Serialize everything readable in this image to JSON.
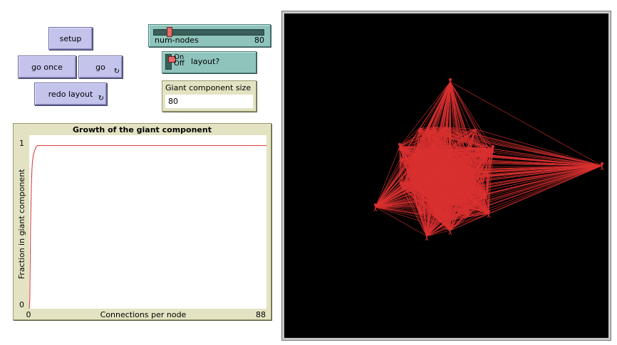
{
  "buttons": {
    "setup": "setup",
    "go_once": "go once",
    "go": "go",
    "redo_layout": "redo layout"
  },
  "slider": {
    "label": "num-nodes",
    "value": "80",
    "fraction": 0.02
  },
  "switch": {
    "label": "layout?",
    "on": "On",
    "off": "Off",
    "state": "on"
  },
  "monitor": {
    "label": "Giant component size",
    "value": "80"
  },
  "plot": {
    "title": "Growth of the giant component",
    "xlabel": "Connections per node",
    "ylabel": "Fraction in giant component",
    "xmin": "0",
    "xmax": "88",
    "ymin": "0",
    "ymax": "1"
  },
  "chart_data": {
    "type": "line",
    "title": "Growth of the giant component",
    "xlabel": "Connections per node",
    "ylabel": "Fraction in giant component",
    "xlim": [
      0,
      88
    ],
    "ylim": [
      0,
      1
    ],
    "series": [
      {
        "color": "#d93030",
        "x": [
          0,
          0.2,
          0.4,
          0.5,
          0.6,
          0.8,
          1.0,
          1.2,
          1.5,
          2.0,
          2.5,
          3.0,
          4.0,
          88
        ],
        "y": [
          0,
          0.05,
          0.35,
          0.5,
          0.6,
          0.75,
          0.85,
          0.9,
          0.94,
          0.97,
          0.99,
          1.0,
          1.0,
          1.0
        ]
      }
    ]
  },
  "colors": {
    "button": "#c3c3ec",
    "slider": "#8fc4bc",
    "monitor": "#e3e3c3",
    "link": "#d93030",
    "view_bg": "#000000"
  }
}
